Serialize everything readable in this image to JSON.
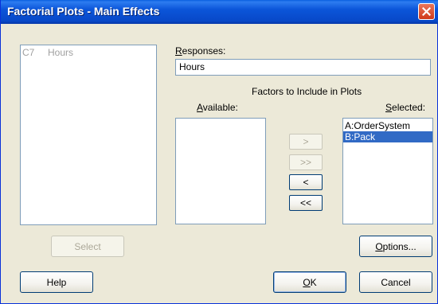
{
  "window": {
    "title": "Factorial Plots - Main Effects"
  },
  "columns_list": {
    "items": [
      {
        "col": "C7",
        "name": "Hours"
      }
    ]
  },
  "responses": {
    "label_prefix": "",
    "label_hot": "R",
    "label_rest": "esponses:",
    "value": "Hours"
  },
  "factors": {
    "heading": "Factors to Include in Plots",
    "available_label_pre": "",
    "available_label_hot": "A",
    "available_label_rest": "vailable:",
    "available_items": [],
    "selected_label_pre": "",
    "selected_label_hot": "S",
    "selected_label_rest": "elected:",
    "selected_items": [
      {
        "label": "A:OrderSystem",
        "selected": false
      },
      {
        "label": "B:Pack",
        "selected": true
      }
    ]
  },
  "move_buttons": {
    "add_one": ">",
    "add_all": ">>",
    "remove_one": "<",
    "remove_all": "<<"
  },
  "buttons": {
    "select": "Select",
    "options_pre": "O",
    "options_rest": "ptions...",
    "help": "Help",
    "ok_hot": "O",
    "ok_rest": "K",
    "cancel": "Cancel"
  }
}
